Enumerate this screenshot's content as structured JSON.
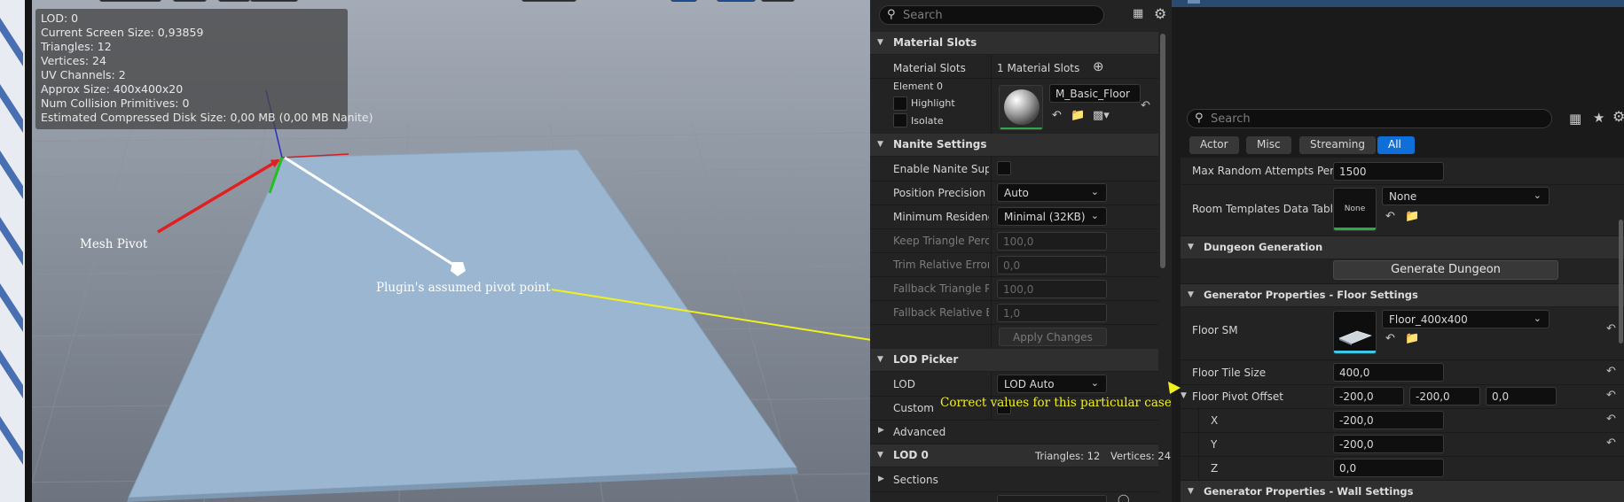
{
  "viewport": {
    "stats": [
      "LOD:  0",
      "Current Screen Size:  0,93859",
      "Triangles:  12",
      "Vertices:  24",
      "UV Channels:  2",
      "Approx Size:  400x400x20",
      "Num Collision Primitives:  0",
      "Estimated Compressed Disk Size: 0,00 MB (0,00 MB Nanite)"
    ],
    "annotations": {
      "mesh_pivot": "Mesh Pivot",
      "assumed_pivot": "Plugin's assumed pivot point",
      "correct_values": "Correct values for this particular case"
    },
    "colors": {
      "arrow_red": "#e02020",
      "arrow_white": "#ffffff",
      "arrow_yellow": "#f0f020"
    }
  },
  "mesh_details": {
    "search_placeholder": "Search",
    "material_slots": {
      "section": "Material Slots",
      "label": "Material Slots",
      "value": "1 Material Slots",
      "element": "Element 0",
      "highlight": "Highlight",
      "isolate": "Isolate",
      "material": "M_Basic_Floor"
    },
    "nanite": {
      "section": "Nanite Settings",
      "rows": [
        {
          "label": "Enable Nanite Suppor",
          "type": "checkbox",
          "dim": false
        },
        {
          "label": "Position Precision",
          "type": "combo",
          "value": "Auto",
          "dim": false
        },
        {
          "label": "Minimum Residency",
          "type": "combo",
          "value": "Minimal (32KB)",
          "dim": false
        },
        {
          "label": "Keep Triangle Percen",
          "type": "field",
          "value": "100,0",
          "dim": true
        },
        {
          "label": "Trim Relative Error",
          "type": "field",
          "value": "0,0",
          "dim": true
        },
        {
          "label": "Fallback Triangle Per",
          "type": "field",
          "value": "100,0",
          "dim": true
        },
        {
          "label": "Fallback Relative Erro",
          "type": "field",
          "value": "1,0",
          "dim": true
        }
      ],
      "apply": "Apply Changes"
    },
    "lod_picker": {
      "section": "LOD Picker",
      "lod_label": "LOD",
      "lod_value": "LOD Auto",
      "custom_label": "Custom",
      "advanced": "Advanced"
    },
    "lod0": {
      "section": "LOD 0",
      "triangles": "Triangles: 12",
      "vertices": "Vertices: 24",
      "sections": "Sections"
    }
  },
  "details": {
    "search_placeholder": "Search",
    "tabs": [
      {
        "label": "Actor",
        "active": false
      },
      {
        "label": "Misc",
        "active": false
      },
      {
        "label": "Streaming",
        "active": false
      },
      {
        "label": "All",
        "active": true
      }
    ],
    "max_random_label": "Max Random Attempts Per Room",
    "max_random_value": "1500",
    "room_templates_label": "Room Templates Data Table",
    "room_templates_thumb": "None",
    "room_templates_value": "None",
    "dungeon_generation": "Dungeon Generation",
    "generate_button": "Generate Dungeon",
    "floor_settings": "Generator Properties - Floor Settings",
    "floor_sm_label": "Floor SM",
    "floor_sm_value": "Floor_400x400",
    "floor_tile_label": "Floor Tile Size",
    "floor_tile_value": "400,0",
    "pivot_label": "Floor Pivot Offset",
    "pivot_x": "-200,0",
    "pivot_y": "-200,0",
    "pivot_z": "0,0",
    "x_label": "X",
    "x_value": "-200,0",
    "y_label": "Y",
    "y_value": "-200,0",
    "z_label": "Z",
    "z_value": "0,0",
    "wall_settings": "Generator Properties - Wall Settings"
  },
  "icons": {
    "search": "search-icon",
    "table": "table-view-icon",
    "settings": "gear-icon",
    "star": "star-icon",
    "add": "add-element-icon",
    "browse": "browse-icon",
    "find": "find-in-browser-icon",
    "reset": "reset-to-default-icon",
    "collapse": "collapse-arrow-icon",
    "expand": "expand-arrow-icon"
  }
}
